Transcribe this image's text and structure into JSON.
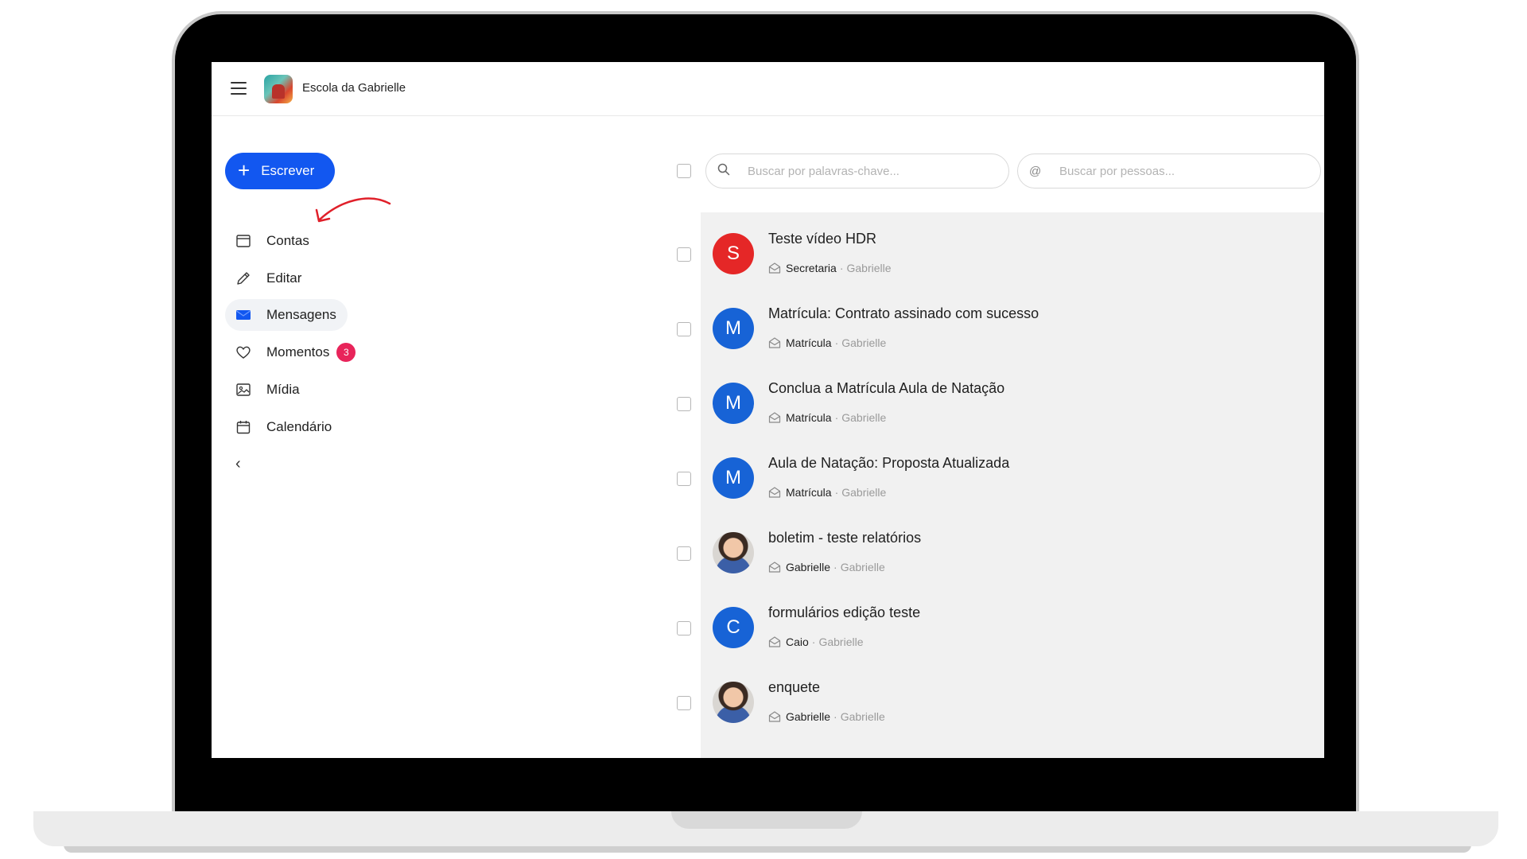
{
  "header": {
    "school_name": "Escola da Gabrielle"
  },
  "sidebar": {
    "compose_label": "Escrever",
    "items": [
      {
        "label": "Contas",
        "icon": "window-icon"
      },
      {
        "label": "Editar",
        "icon": "pencil-icon"
      },
      {
        "label": "Mensagens",
        "icon": "envelope-icon",
        "active": true
      },
      {
        "label": "Momentos",
        "icon": "heart-icon",
        "badge": "3"
      },
      {
        "label": "Mídia",
        "icon": "image-icon"
      },
      {
        "label": "Calendário",
        "icon": "calendar-icon"
      }
    ]
  },
  "search": {
    "keywords_placeholder": "Buscar por palavras-chave...",
    "people_placeholder": "Buscar por pessoas...",
    "people_prefix": "@"
  },
  "messages": [
    {
      "subject": "Teste vídeo HDR",
      "sender": "Secretaria",
      "recipient": "Gabrielle",
      "avatar_letter": "S",
      "avatar_color": "#e52727"
    },
    {
      "subject": "Matrícula: Contrato assinado com sucesso",
      "sender": "Matrícula",
      "recipient": "Gabrielle",
      "avatar_letter": "M",
      "avatar_color": "#1763d6"
    },
    {
      "subject": "Conclua a Matrícula Aula de Natação",
      "sender": "Matrícula",
      "recipient": "Gabrielle",
      "avatar_letter": "M",
      "avatar_color": "#1763d6"
    },
    {
      "subject": "Aula de Natação: Proposta Atualizada",
      "sender": "Matrícula",
      "recipient": "Gabrielle",
      "avatar_letter": "M",
      "avatar_color": "#1763d6"
    },
    {
      "subject": "boletim - teste relatórios",
      "sender": "Gabrielle",
      "recipient": "Gabrielle",
      "avatar_letter": "",
      "avatar_color": ""
    },
    {
      "subject": "formulários edição teste",
      "sender": "Caio",
      "recipient": "Gabrielle",
      "avatar_letter": "C",
      "avatar_color": "#1763d6"
    },
    {
      "subject": "enquete",
      "sender": "Gabrielle",
      "recipient": "Gabrielle",
      "avatar_letter": "",
      "avatar_color": ""
    }
  ],
  "colors": {
    "primary": "#1257f0",
    "badge": "#e8245a",
    "annotation_arrow": "#e0202a"
  }
}
